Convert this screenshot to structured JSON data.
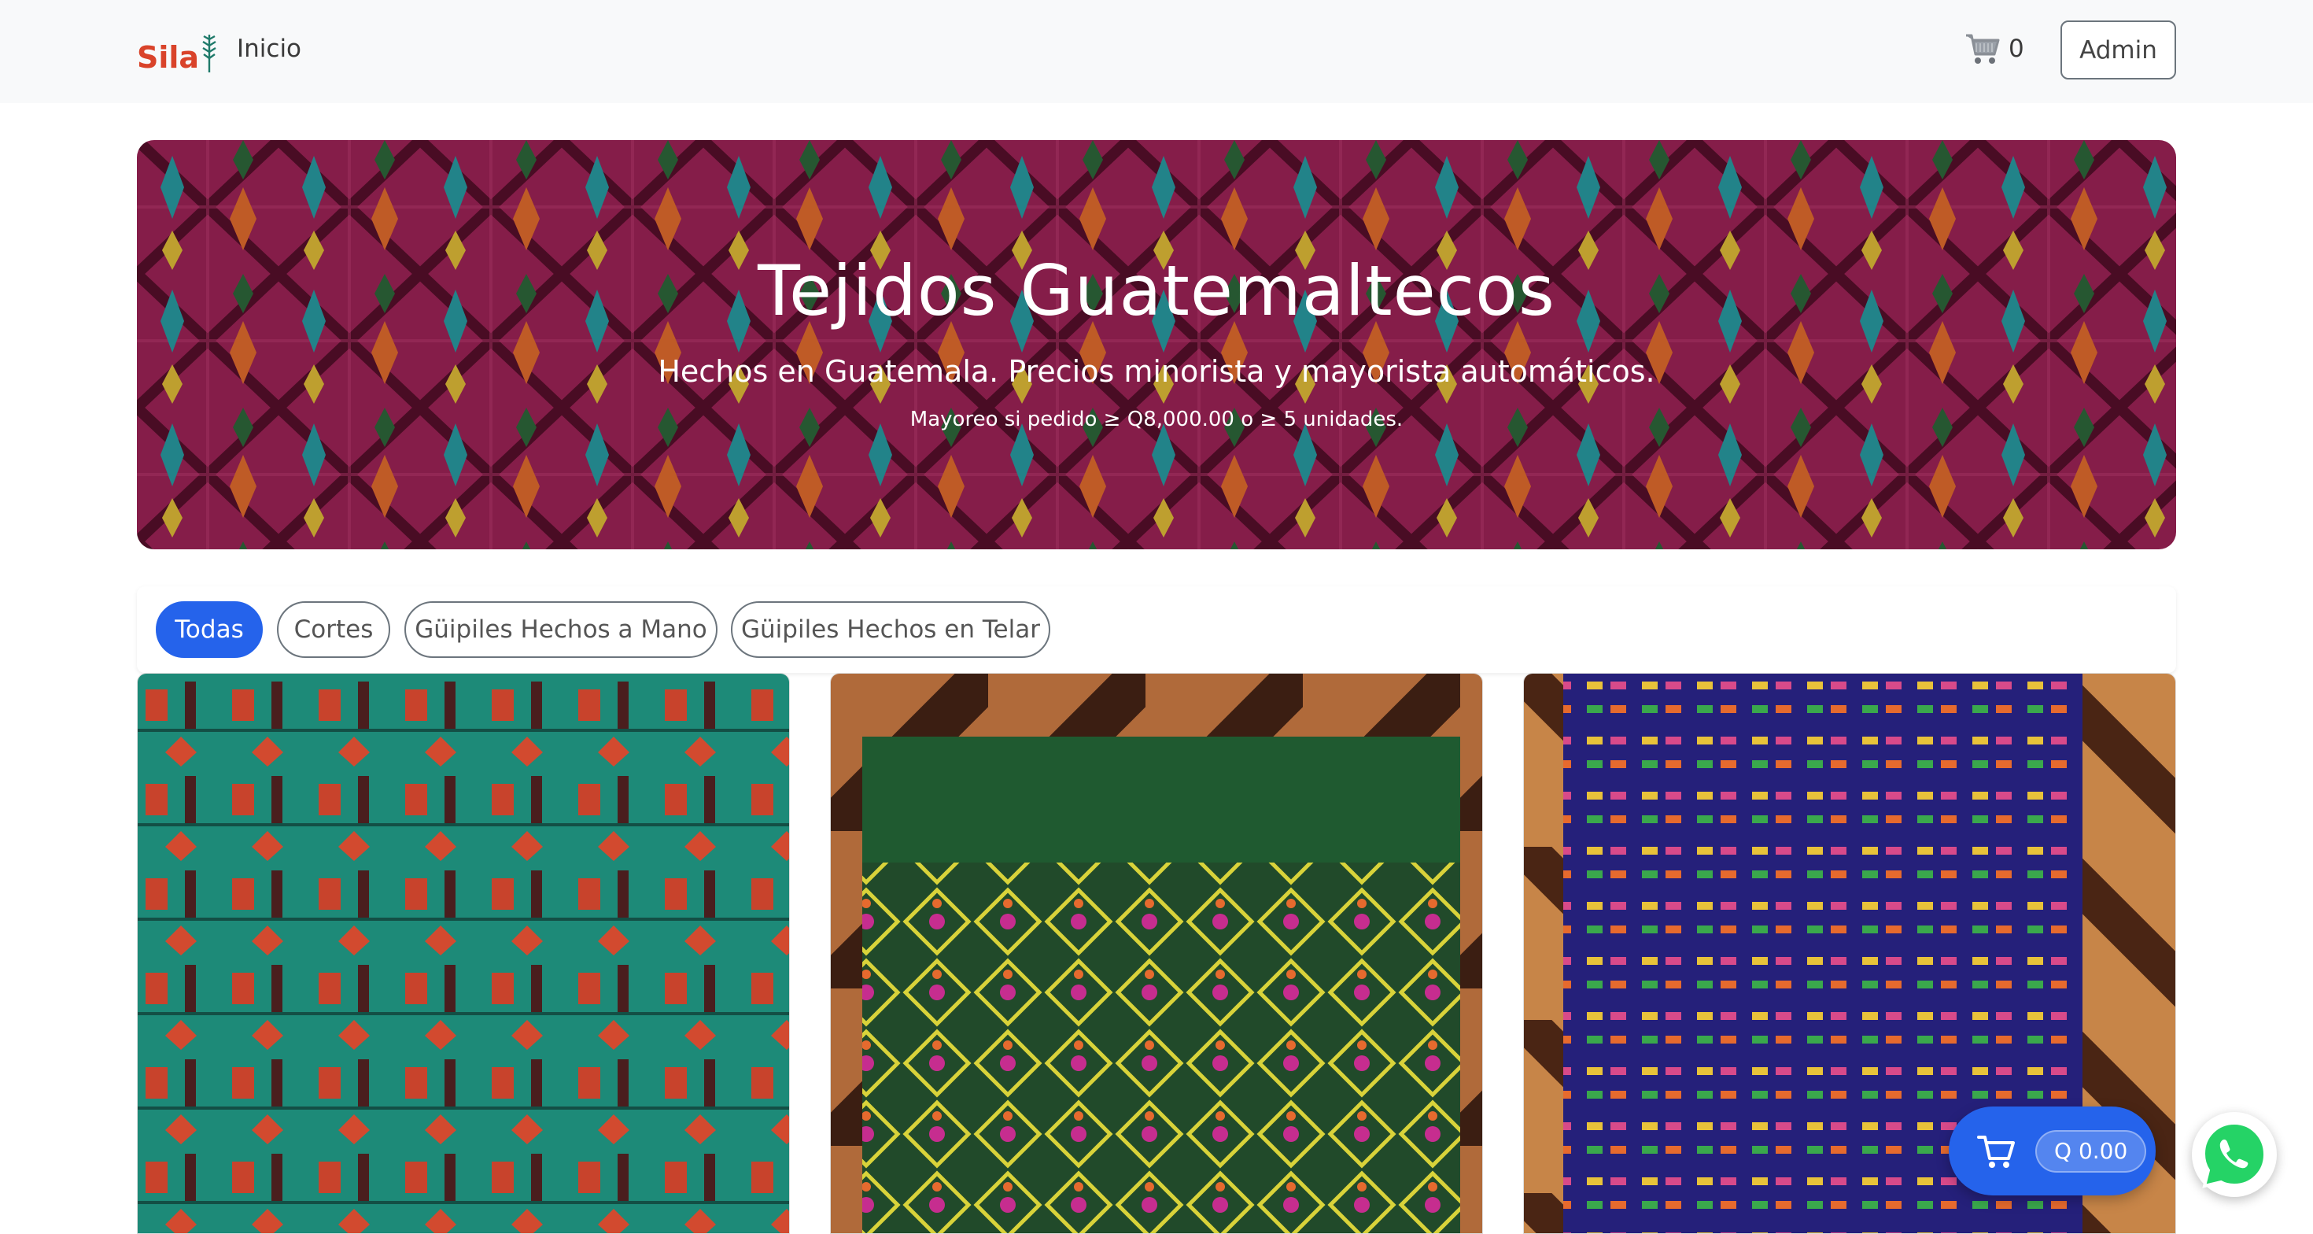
{
  "navbar": {
    "brand": "Sila",
    "home_link": "Inicio",
    "cart_count": "0",
    "admin_button": "Admin",
    "cart_icon": "cart-icon"
  },
  "hero": {
    "title": "Tejidos Guatemaltecos",
    "subtitle": "Hechos en Guatemala. Precios minorista y mayorista automáticos.",
    "note": "Mayoreo si pedido ≥ Q8,000.00 o ≥ 5 unidades."
  },
  "filters": [
    {
      "label": "Todas",
      "active": true
    },
    {
      "label": "Cortes",
      "active": false
    },
    {
      "label": "Güipiles Hechos a Mano",
      "active": false
    },
    {
      "label": "Güipiles Hechos en Telar",
      "active": false
    }
  ],
  "floating_cart": {
    "total": "Q 0.00",
    "icon": "cart-icon"
  },
  "whatsapp": {
    "icon": "whatsapp-icon"
  },
  "colors": {
    "accent": "#2563eb",
    "brand": "#d9432a",
    "whatsapp": "#25d366"
  }
}
